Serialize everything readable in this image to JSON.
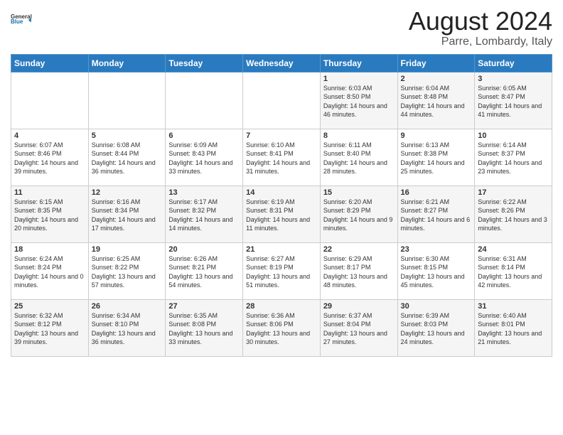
{
  "header": {
    "logo_line1": "General",
    "logo_line2": "Blue",
    "main_title": "August 2024",
    "sub_title": "Parre, Lombardy, Italy"
  },
  "days_of_week": [
    "Sunday",
    "Monday",
    "Tuesday",
    "Wednesday",
    "Thursday",
    "Friday",
    "Saturday"
  ],
  "weeks": [
    [
      {
        "day": "",
        "content": ""
      },
      {
        "day": "",
        "content": ""
      },
      {
        "day": "",
        "content": ""
      },
      {
        "day": "",
        "content": ""
      },
      {
        "day": "1",
        "content": "Sunrise: 6:03 AM\nSunset: 8:50 PM\nDaylight: 14 hours and 46 minutes."
      },
      {
        "day": "2",
        "content": "Sunrise: 6:04 AM\nSunset: 8:48 PM\nDaylight: 14 hours and 44 minutes."
      },
      {
        "day": "3",
        "content": "Sunrise: 6:05 AM\nSunset: 8:47 PM\nDaylight: 14 hours and 41 minutes."
      }
    ],
    [
      {
        "day": "4",
        "content": "Sunrise: 6:07 AM\nSunset: 8:46 PM\nDaylight: 14 hours and 39 minutes."
      },
      {
        "day": "5",
        "content": "Sunrise: 6:08 AM\nSunset: 8:44 PM\nDaylight: 14 hours and 36 minutes."
      },
      {
        "day": "6",
        "content": "Sunrise: 6:09 AM\nSunset: 8:43 PM\nDaylight: 14 hours and 33 minutes."
      },
      {
        "day": "7",
        "content": "Sunrise: 6:10 AM\nSunset: 8:41 PM\nDaylight: 14 hours and 31 minutes."
      },
      {
        "day": "8",
        "content": "Sunrise: 6:11 AM\nSunset: 8:40 PM\nDaylight: 14 hours and 28 minutes."
      },
      {
        "day": "9",
        "content": "Sunrise: 6:13 AM\nSunset: 8:38 PM\nDaylight: 14 hours and 25 minutes."
      },
      {
        "day": "10",
        "content": "Sunrise: 6:14 AM\nSunset: 8:37 PM\nDaylight: 14 hours and 23 minutes."
      }
    ],
    [
      {
        "day": "11",
        "content": "Sunrise: 6:15 AM\nSunset: 8:35 PM\nDaylight: 14 hours and 20 minutes."
      },
      {
        "day": "12",
        "content": "Sunrise: 6:16 AM\nSunset: 8:34 PM\nDaylight: 14 hours and 17 minutes."
      },
      {
        "day": "13",
        "content": "Sunrise: 6:17 AM\nSunset: 8:32 PM\nDaylight: 14 hours and 14 minutes."
      },
      {
        "day": "14",
        "content": "Sunrise: 6:19 AM\nSunset: 8:31 PM\nDaylight: 14 hours and 11 minutes."
      },
      {
        "day": "15",
        "content": "Sunrise: 6:20 AM\nSunset: 8:29 PM\nDaylight: 14 hours and 9 minutes."
      },
      {
        "day": "16",
        "content": "Sunrise: 6:21 AM\nSunset: 8:27 PM\nDaylight: 14 hours and 6 minutes."
      },
      {
        "day": "17",
        "content": "Sunrise: 6:22 AM\nSunset: 8:26 PM\nDaylight: 14 hours and 3 minutes."
      }
    ],
    [
      {
        "day": "18",
        "content": "Sunrise: 6:24 AM\nSunset: 8:24 PM\nDaylight: 14 hours and 0 minutes."
      },
      {
        "day": "19",
        "content": "Sunrise: 6:25 AM\nSunset: 8:22 PM\nDaylight: 13 hours and 57 minutes."
      },
      {
        "day": "20",
        "content": "Sunrise: 6:26 AM\nSunset: 8:21 PM\nDaylight: 13 hours and 54 minutes."
      },
      {
        "day": "21",
        "content": "Sunrise: 6:27 AM\nSunset: 8:19 PM\nDaylight: 13 hours and 51 minutes."
      },
      {
        "day": "22",
        "content": "Sunrise: 6:29 AM\nSunset: 8:17 PM\nDaylight: 13 hours and 48 minutes."
      },
      {
        "day": "23",
        "content": "Sunrise: 6:30 AM\nSunset: 8:15 PM\nDaylight: 13 hours and 45 minutes."
      },
      {
        "day": "24",
        "content": "Sunrise: 6:31 AM\nSunset: 8:14 PM\nDaylight: 13 hours and 42 minutes."
      }
    ],
    [
      {
        "day": "25",
        "content": "Sunrise: 6:32 AM\nSunset: 8:12 PM\nDaylight: 13 hours and 39 minutes."
      },
      {
        "day": "26",
        "content": "Sunrise: 6:34 AM\nSunset: 8:10 PM\nDaylight: 13 hours and 36 minutes."
      },
      {
        "day": "27",
        "content": "Sunrise: 6:35 AM\nSunset: 8:08 PM\nDaylight: 13 hours and 33 minutes."
      },
      {
        "day": "28",
        "content": "Sunrise: 6:36 AM\nSunset: 8:06 PM\nDaylight: 13 hours and 30 minutes."
      },
      {
        "day": "29",
        "content": "Sunrise: 6:37 AM\nSunset: 8:04 PM\nDaylight: 13 hours and 27 minutes."
      },
      {
        "day": "30",
        "content": "Sunrise: 6:39 AM\nSunset: 8:03 PM\nDaylight: 13 hours and 24 minutes."
      },
      {
        "day": "31",
        "content": "Sunrise: 6:40 AM\nSunset: 8:01 PM\nDaylight: 13 hours and 21 minutes."
      }
    ]
  ]
}
